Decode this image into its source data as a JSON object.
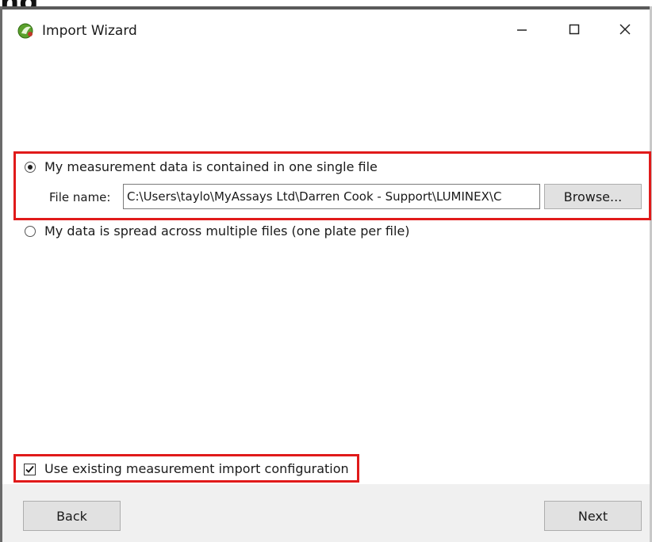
{
  "window": {
    "title": "Import Wizard",
    "icon": "app-icon",
    "controls": {
      "minimize": "minimize-icon",
      "maximize": "maximize-icon",
      "close": "close-icon"
    }
  },
  "source_options": {
    "single_file": {
      "label": "My measurement data is contained in one single file",
      "selected": true
    },
    "file_name_label": "File name:",
    "file_name_value": "C:\\Users\\taylo\\MyAssays Ltd\\Darren Cook - Support\\LUMINEX\\C",
    "browse_label": "Browse...",
    "multiple_files": {
      "label": "My data is spread across multiple files (one plate per file)",
      "selected": false
    }
  },
  "configuration": {
    "label": "Use existing measurement import configuration",
    "checked": true
  },
  "footer": {
    "back_label": "Back",
    "next_label": "Next"
  },
  "colors": {
    "highlight": "#e01a1a",
    "footer_bg": "#f0f0f0",
    "button_bg": "#e1e1e1"
  }
}
